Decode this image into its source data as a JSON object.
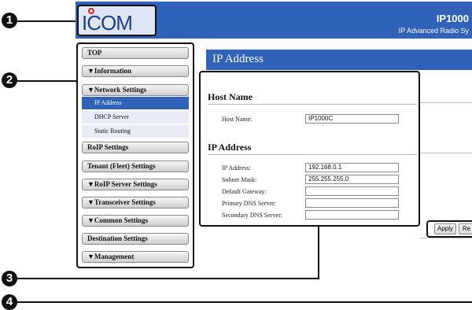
{
  "callouts": {
    "c1": "1",
    "c2": "2",
    "c3": "3",
    "c4": "4"
  },
  "header": {
    "logo": "ICOM",
    "model": "IP1000",
    "subtitle": "IP Advanced Radio Sy"
  },
  "sidebar": {
    "items": [
      {
        "label": "TOP"
      },
      {
        "label": "▼Information"
      },
      {
        "label": "▼Network Settings"
      },
      {
        "label": "IP Address"
      },
      {
        "label": "DHCP Server"
      },
      {
        "label": "Static Routing"
      },
      {
        "label": "RoIP Settings"
      },
      {
        "label": "Tenant (Fleet) Settings"
      },
      {
        "label": "▼RoIP Server Settings"
      },
      {
        "label": "▼Transceiver Settings"
      },
      {
        "label": "▼Common Settings"
      },
      {
        "label": "Destination Settings"
      },
      {
        "label": "▼Management"
      }
    ]
  },
  "content": {
    "title": "IP Address",
    "host_section": {
      "title": "Host Name",
      "host_label": "Host Name:",
      "host_value": "IP1000C"
    },
    "ip_section": {
      "title": "IP Address",
      "fields": [
        {
          "label": "IP Address:",
          "value": "192.168.0.1"
        },
        {
          "label": "Subnet Mask:",
          "value": "255.255.255.0"
        },
        {
          "label": "Default Gateway:",
          "value": ""
        },
        {
          "label": "Primary DNS Server:",
          "value": ""
        },
        {
          "label": "Secondary DNS Server:",
          "value": ""
        }
      ]
    },
    "buttons": {
      "apply": "Apply",
      "reset": "Re"
    }
  },
  "colors": {
    "accent": "#2f62b8",
    "callout": "#111111"
  }
}
